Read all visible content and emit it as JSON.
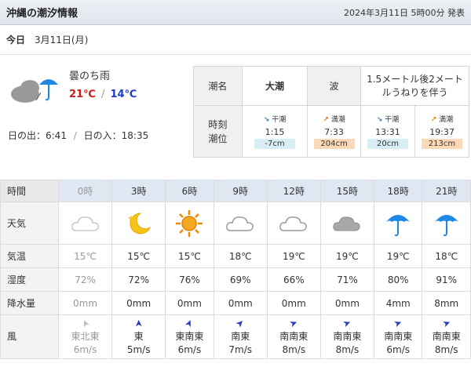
{
  "header": {
    "title": "沖縄の潮汐情報",
    "timestamp": "2024年3月11日 5時00分 発表"
  },
  "today": {
    "label": "今日",
    "date": "3月11日(月)"
  },
  "weather": {
    "summary": "曇のち雨",
    "high": "21℃",
    "low": "14℃",
    "icon": "cloud-then-rain-icon",
    "sunrise": "日の出：6:41",
    "separator": "/",
    "sunset": "日の入：18:35"
  },
  "tide": {
    "name_label": "潮名",
    "name_value": "大潮",
    "wave_label": "波",
    "wave_value": "1.5メートル後2メートルうねりを伴う",
    "time_label": "時刻潮位",
    "entries": [
      {
        "type": "干潮",
        "dir": "↘",
        "time": "1:15",
        "level": "-7cm"
      },
      {
        "type": "満潮",
        "dir": "↗",
        "time": "7:33",
        "level": "204cm"
      },
      {
        "type": "干潮",
        "dir": "↘",
        "time": "13:31",
        "level": "20cm"
      },
      {
        "type": "満潮",
        "dir": "↗",
        "time": "19:37",
        "level": "213cm"
      }
    ]
  },
  "forecast": {
    "labels": {
      "time": "時間",
      "weather": "天気",
      "temp": "気温",
      "humidity": "湿度",
      "precip": "降水量",
      "wind": "風"
    },
    "hours": [
      "0時",
      "3時",
      "6時",
      "9時",
      "12時",
      "15時",
      "18時",
      "21時"
    ],
    "icons": [
      "cloud-icon",
      "moon-icon",
      "sun-icon",
      "cloud-icon",
      "cloud-icon",
      "dark-cloud-icon",
      "umbrella-icon",
      "umbrella-icon"
    ],
    "temps": [
      "15℃",
      "15℃",
      "15℃",
      "18℃",
      "19℃",
      "19℃",
      "19℃",
      "18℃"
    ],
    "humidity": [
      "72%",
      "72%",
      "76%",
      "69%",
      "66%",
      "71%",
      "80%",
      "91%"
    ],
    "precip": [
      "0mm",
      "0mm",
      "0mm",
      "0mm",
      "0mm",
      "0mm",
      "4mm",
      "8mm"
    ],
    "wind_dir": [
      "東北東",
      "東",
      "東南東",
      "南東",
      "南南東",
      "南南東",
      "南南東",
      "南南東"
    ],
    "wind_speed": [
      "6m/s",
      "5m/s",
      "6m/s",
      "7m/s",
      "8m/s",
      "8m/s",
      "6m/s",
      "8m/s"
    ],
    "wind_angle_deg": [
      245,
      270,
      293,
      315,
      338,
      338,
      338,
      338
    ]
  },
  "colors": {
    "high_temp": "#d01818",
    "low_temp": "#1c3ec4",
    "low_tide_chip": "#d7eef4",
    "high_tide_chip": "#fbd8b8",
    "hour_header_bg": "#dfe7f3"
  }
}
